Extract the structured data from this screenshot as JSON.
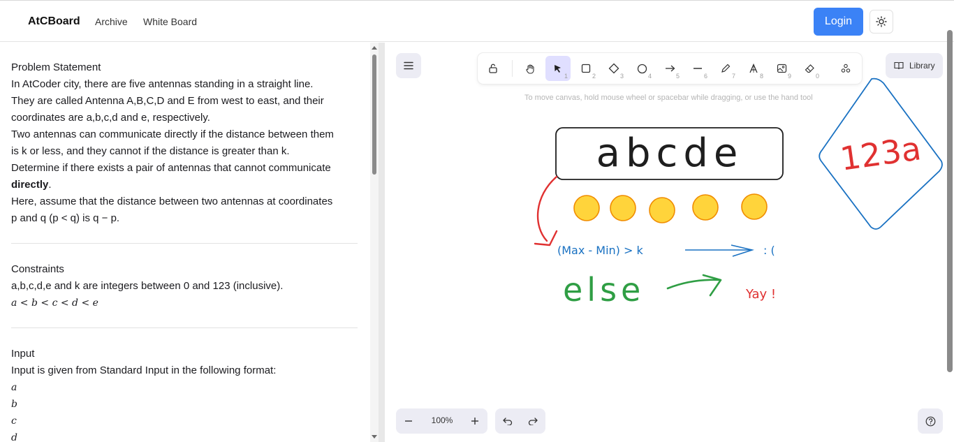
{
  "header": {
    "brand": "AtCBoard",
    "nav": [
      "Archive",
      "White Board"
    ],
    "login_label": "Login",
    "theme_icon": "sun-icon"
  },
  "problem": {
    "statement_title": "Problem Statement",
    "statement_lines": [
      "In AtCoder city, there are five antennas standing in a straight line.",
      "They are called Antenna A,B,C,D and E from west to east, and their",
      "coordinates are a,b,c,d and e, respectively.",
      "Two antennas can communicate directly if the distance between them",
      "is k or less, and they cannot if the distance is greater than k.",
      "Determine if there exists a pair of antennas that cannot communicate"
    ],
    "bold_word": "directly",
    "statement_tail": "Here, assume that the distance between two antennas at coordinates",
    "statement_formula": "p and q (p < q) is q − p.",
    "constraints_title": "Constraints",
    "constraint_1": "a,b,c,d,e and k are integers between 0 and 123 (inclusive).",
    "constraint_2": "a < b < c < d < e",
    "input_title": "Input",
    "input_desc": "Input is given from Standard Input in the following format:",
    "input_vars": [
      "a",
      "b",
      "c",
      "d"
    ]
  },
  "canvas": {
    "hint": "To move canvas, hold mouse wheel or spacebar while dragging, or use the hand tool",
    "library_label": "Library",
    "zoom": "100%",
    "tools": [
      {
        "icon": "lock-icon",
        "num": ""
      },
      {
        "icon": "hand-icon",
        "num": ""
      },
      {
        "icon": "pointer-icon",
        "num": "1"
      },
      {
        "icon": "rectangle-icon",
        "num": "2"
      },
      {
        "icon": "diamond-icon",
        "num": "3"
      },
      {
        "icon": "ellipse-icon",
        "num": "4"
      },
      {
        "icon": "arrow-icon",
        "num": "5"
      },
      {
        "icon": "line-icon",
        "num": "6"
      },
      {
        "icon": "pencil-icon",
        "num": "7"
      },
      {
        "icon": "text-icon",
        "num": "8"
      },
      {
        "icon": "image-icon",
        "num": "9"
      },
      {
        "icon": "eraser-icon",
        "num": "0"
      },
      {
        "icon": "shapes-icon",
        "num": ""
      }
    ],
    "drawing": {
      "box_text": "abcde",
      "diamond_text": "123a",
      "formula_text": "(Max - Min) > k",
      "sad_text": ": (",
      "else_text": "else",
      "yay_text": "Yay !"
    }
  },
  "colors": {
    "accent": "#3b82f6",
    "tool_active": "#e0dfff",
    "ink_black": "#1e1e1e",
    "ink_red": "#e03131",
    "ink_blue": "#1971c2",
    "ink_green": "#2f9e44",
    "circle_fill": "#ffd43b",
    "circle_stroke": "#f08c00"
  }
}
